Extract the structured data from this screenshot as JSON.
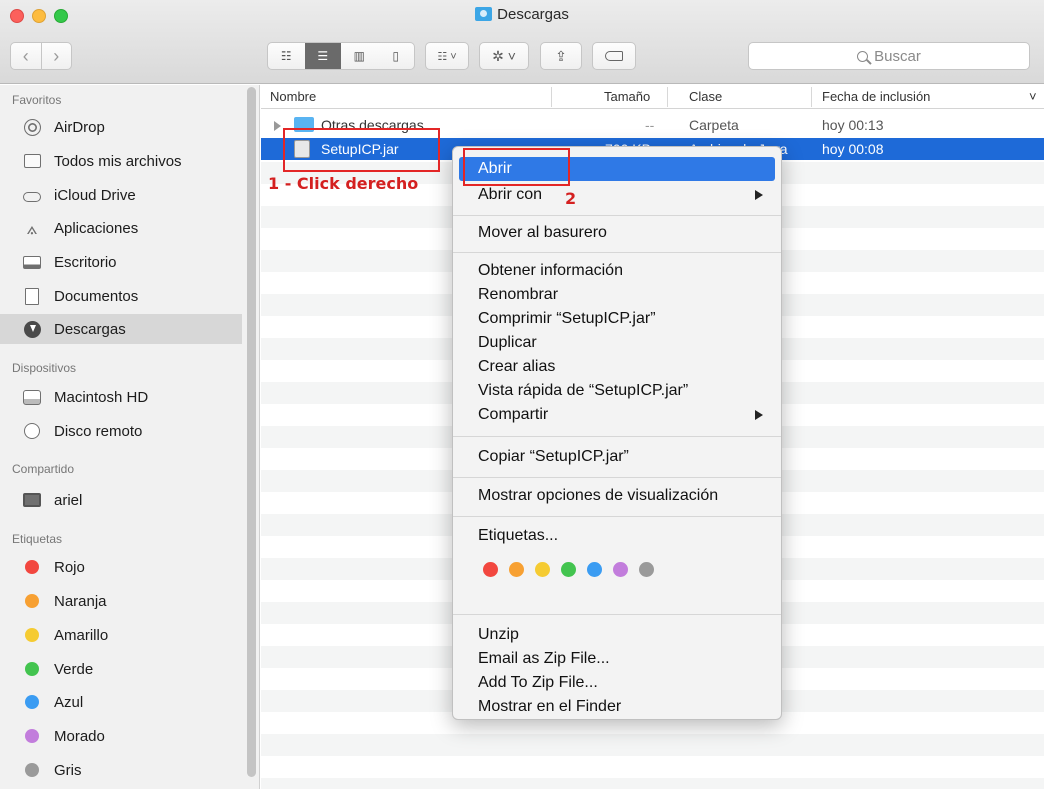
{
  "window": {
    "title": "Descargas"
  },
  "toolbar": {
    "back": "‹",
    "forward": "›",
    "view_icons": "☷",
    "view_list": "☰",
    "view_columns": "▥",
    "view_coverflow": "▯",
    "arrange": "☷ ˅",
    "action": "✲ ˅",
    "share": "⇪",
    "search_placeholder": "Buscar"
  },
  "sidebar": {
    "favorites_title": "Favoritos",
    "favorites": [
      {
        "label": "AirDrop",
        "icon": "airdrop-icon"
      },
      {
        "label": "Todos mis archivos",
        "icon": "all-files-icon"
      },
      {
        "label": "iCloud Drive",
        "icon": "cloud-icon"
      },
      {
        "label": "Aplicaciones",
        "icon": "applications-icon"
      },
      {
        "label": "Escritorio",
        "icon": "desktop-icon"
      },
      {
        "label": "Documentos",
        "icon": "documents-icon"
      },
      {
        "label": "Descargas",
        "icon": "downloads-icon",
        "selected": true
      }
    ],
    "devices_title": "Dispositivos",
    "devices": [
      {
        "label": "Macintosh HD",
        "icon": "hard-drive-icon"
      },
      {
        "label": "Disco remoto",
        "icon": "remote-disc-icon"
      }
    ],
    "shared_title": "Compartido",
    "shared": [
      {
        "label": "ariel",
        "icon": "computer-icon"
      }
    ],
    "tags_title": "Etiquetas",
    "tags": [
      {
        "label": "Rojo",
        "color": "#f2473f"
      },
      {
        "label": "Naranja",
        "color": "#f7a032"
      },
      {
        "label": "Amarillo",
        "color": "#f5cb32"
      },
      {
        "label": "Verde",
        "color": "#43c44f"
      },
      {
        "label": "Azul",
        "color": "#3b9cf2"
      },
      {
        "label": "Morado",
        "color": "#c27ddc"
      },
      {
        "label": "Gris",
        "color": "#9a9a9a"
      }
    ]
  },
  "columns": {
    "name": "Nombre",
    "size": "Tamaño",
    "kind": "Clase",
    "date": "Fecha de inclusión",
    "sort_indicator": "˅"
  },
  "files": [
    {
      "name": "Otras descargas",
      "size": "--",
      "kind": "Carpeta",
      "date": "hoy 00:13"
    },
    {
      "name": "SetupICP.jar",
      "size": "700 KB",
      "kind": "Archiv...de Java",
      "date": "hoy 00:08"
    }
  ],
  "context_menu": {
    "open": "Abrir",
    "open_with": "Abrir con",
    "move_to_trash": "Mover al basurero",
    "get_info": "Obtener información",
    "rename": "Renombrar",
    "compress": "Comprimir “SetupICP.jar”",
    "duplicate": "Duplicar",
    "make_alias": "Crear alias",
    "quick_look": "Vista rápida de “SetupICP.jar”",
    "share": "Compartir",
    "copy": "Copiar “SetupICP.jar”",
    "view_options": "Mostrar opciones de visualización",
    "tags": "Etiquetas...",
    "tag_colors": [
      "#f2473f",
      "#f7a032",
      "#f5cb32",
      "#43c44f",
      "#3b9cf2",
      "#c27ddc",
      "#9a9a9a"
    ],
    "unzip": "Unzip",
    "email_zip": "Email as Zip File...",
    "add_zip": "Add To Zip File...",
    "show_in_finder": "Mostrar en el Finder"
  },
  "annotations": {
    "step1": "1 - Click derecho",
    "step2": "2"
  }
}
